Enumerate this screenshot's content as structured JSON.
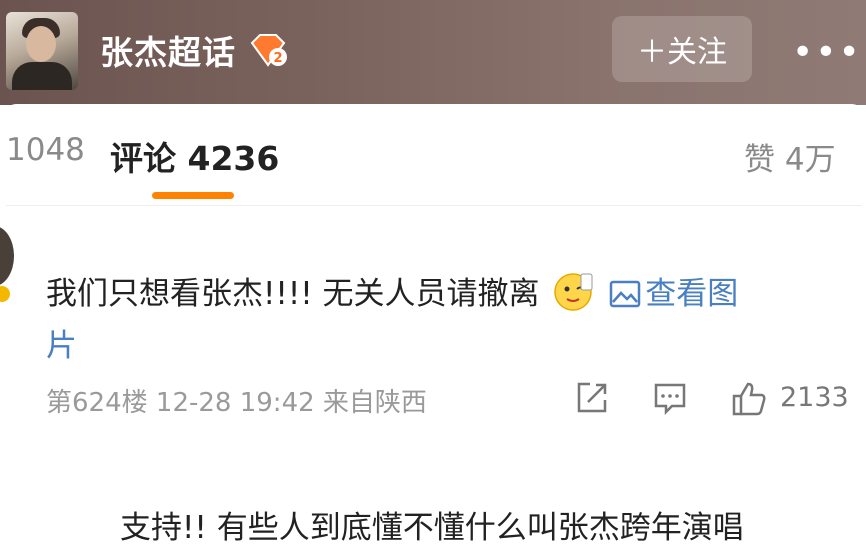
{
  "header": {
    "title": "张杰超话",
    "follow_label": "＋关注",
    "more_label": "•••",
    "badge_level": "2"
  },
  "tabs": {
    "left_partial": "1048",
    "active": "评论 4236",
    "right": "赞 4万"
  },
  "comment": {
    "text": "我们只想看张杰!!!! 无关人员请撤离",
    "link_label_a": "查看图",
    "link_label_b": "片",
    "floor": "第624楼",
    "time": "12-28 19:42",
    "location": "来自陕西",
    "like_count": "2133"
  },
  "comment2": {
    "text": "支持!! 有些人到底懂不懂什么叫张杰跨年演唱"
  },
  "colors": {
    "accent": "#ff8200",
    "link": "#4a7fc1"
  }
}
